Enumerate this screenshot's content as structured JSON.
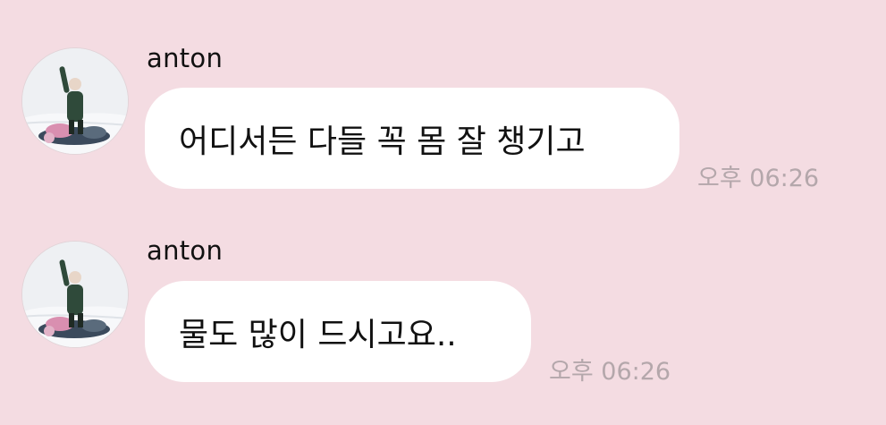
{
  "messages": [
    {
      "sender": "anton",
      "text": "어디서든 다들 꼭 몸 잘 챙기고",
      "time": "오후 06:26",
      "avatar_icon": "profile-photo-snowmobile"
    },
    {
      "sender": "anton",
      "text": "물도 많이 드시고요..",
      "time": "오후 06:26",
      "avatar_icon": "profile-photo-snowmobile"
    }
  ],
  "colors": {
    "background": "#f4dce2",
    "bubble": "#ffffff",
    "text": "#111111",
    "timestamp": "#b4a7ab"
  }
}
